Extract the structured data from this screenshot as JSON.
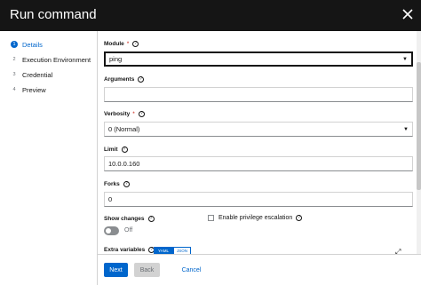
{
  "window": {
    "title": "Run command"
  },
  "steps": [
    {
      "num": "1",
      "label": "Details",
      "active": true
    },
    {
      "num": "2",
      "label": "Execution Environment",
      "active": false
    },
    {
      "num": "3",
      "label": "Credential",
      "active": false
    },
    {
      "num": "4",
      "label": "Preview",
      "active": false
    }
  ],
  "form": {
    "module": {
      "label": "Module",
      "required": "*",
      "value": "ping"
    },
    "arguments": {
      "label": "Arguments",
      "value": ""
    },
    "verbosity": {
      "label": "Verbosity",
      "required": "*",
      "value": "0 (Normal)"
    },
    "limit": {
      "label": "Limit",
      "value": "10.0.0.160"
    },
    "forks": {
      "label": "Forks",
      "value": "0"
    },
    "show_changes": {
      "label": "Show changes",
      "state": "Off"
    },
    "privilege_escalation": {
      "label": "Enable privilege escalation",
      "checked": false
    },
    "extra_variables": {
      "label": "Extra variables",
      "modes": [
        "YAML",
        "JSON"
      ],
      "selected": "YAML"
    }
  },
  "footer": {
    "next": "Next",
    "back": "Back",
    "cancel": "Cancel"
  },
  "icons": {
    "close": "close-icon",
    "help": "help-icon",
    "dropdown": "caret-down-icon",
    "expand": "expand-icon"
  },
  "colors": {
    "header": "#151515",
    "accent": "#0066cc",
    "required": "#c9190b"
  }
}
